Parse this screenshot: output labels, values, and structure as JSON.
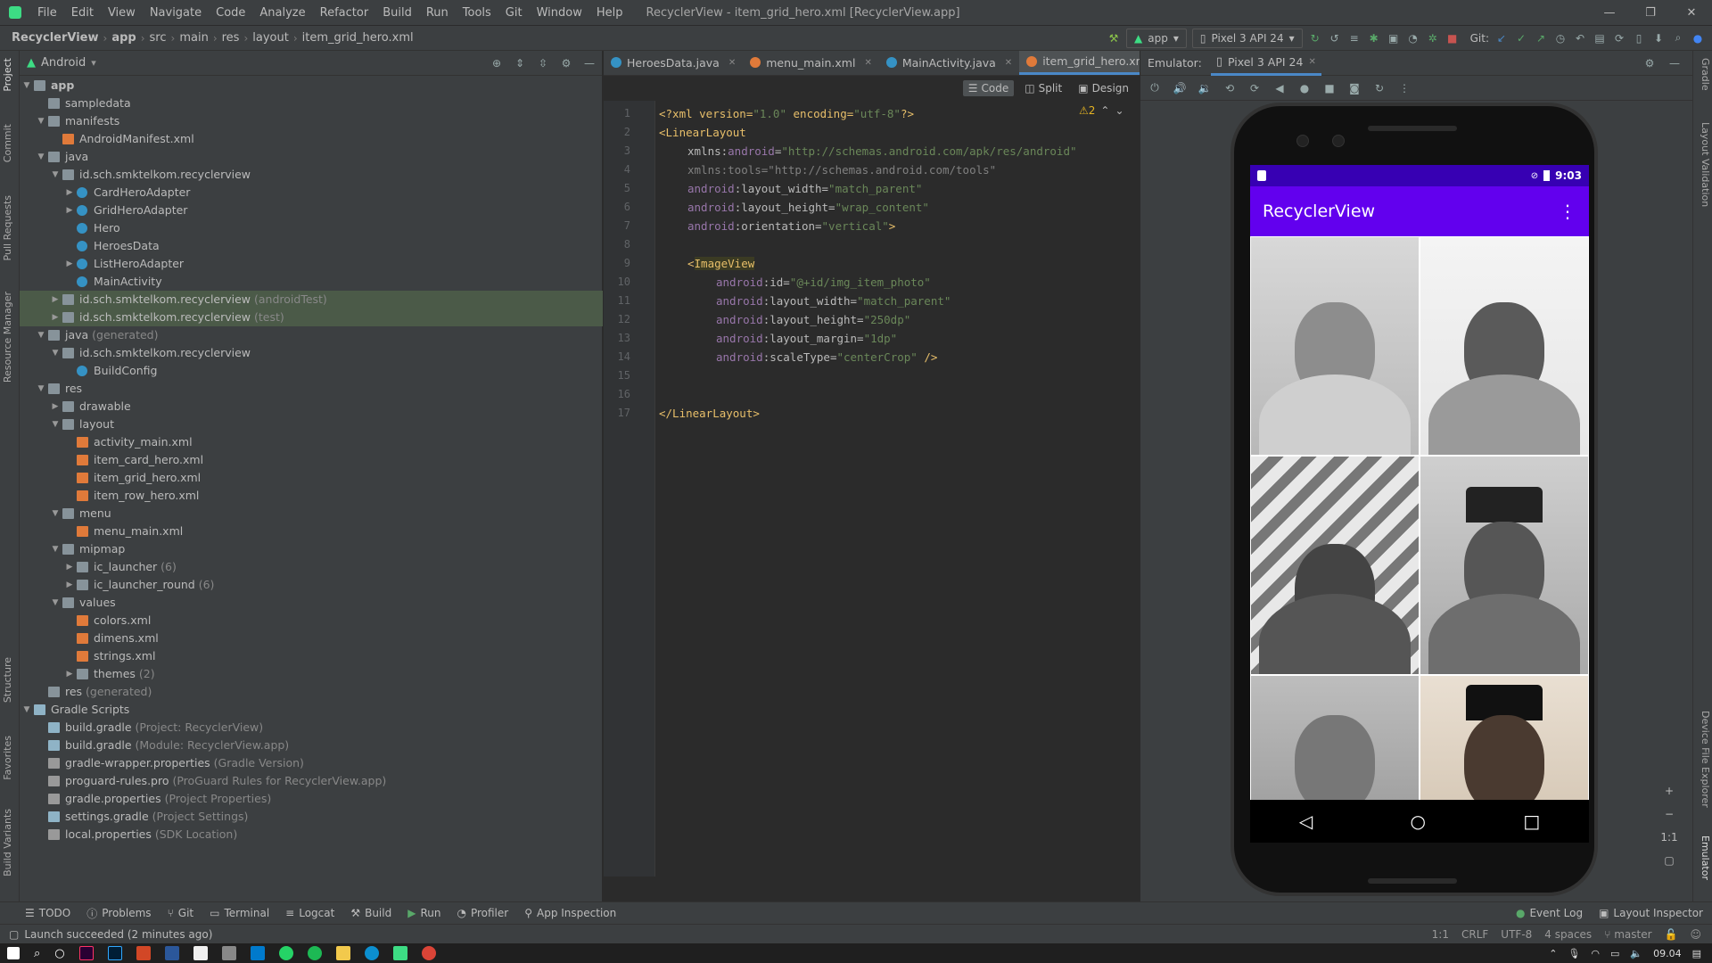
{
  "window": {
    "title": "RecyclerView - item_grid_hero.xml [RecyclerView.app]",
    "menu": [
      "File",
      "Edit",
      "View",
      "Navigate",
      "Code",
      "Analyze",
      "Refactor",
      "Build",
      "Run",
      "Tools",
      "Git",
      "Window",
      "Help"
    ],
    "controls": [
      "—",
      "❐",
      "✕"
    ]
  },
  "breadcrumb": [
    "RecyclerView",
    "app",
    "src",
    "main",
    "res",
    "layout",
    "item_grid_hero.xml"
  ],
  "toolbar": {
    "run_config": "app",
    "device": "Pixel 3 API 24",
    "git_label": "Git:"
  },
  "project_panel": {
    "view_mode": "Android",
    "tree": [
      {
        "label": "app",
        "hint": "",
        "type": "folder",
        "depth": 0,
        "expanded": true,
        "bold": true
      },
      {
        "label": "sampledata",
        "hint": "",
        "type": "folder",
        "depth": 1,
        "expanded": null
      },
      {
        "label": "manifests",
        "hint": "",
        "type": "folder",
        "depth": 1,
        "expanded": true
      },
      {
        "label": "AndroidManifest.xml",
        "hint": "",
        "type": "xml",
        "depth": 2,
        "expanded": null
      },
      {
        "label": "java",
        "hint": "",
        "type": "folder",
        "depth": 1,
        "expanded": true
      },
      {
        "label": "id.sch.smktelkom.recyclerview",
        "hint": "",
        "type": "pkg",
        "depth": 2,
        "expanded": true
      },
      {
        "label": "CardHeroAdapter",
        "hint": "",
        "type": "cls",
        "depth": 3,
        "expanded": false
      },
      {
        "label": "GridHeroAdapter",
        "hint": "",
        "type": "cls",
        "depth": 3,
        "expanded": false
      },
      {
        "label": "Hero",
        "hint": "",
        "type": "cls",
        "depth": 3,
        "expanded": null
      },
      {
        "label": "HeroesData",
        "hint": "",
        "type": "cls",
        "depth": 3,
        "expanded": null
      },
      {
        "label": "ListHeroAdapter",
        "hint": "",
        "type": "cls",
        "depth": 3,
        "expanded": false
      },
      {
        "label": "MainActivity",
        "hint": "",
        "type": "cls",
        "depth": 3,
        "expanded": null
      },
      {
        "label": "id.sch.smktelkom.recyclerview",
        "hint": " (androidTest)",
        "type": "pkg",
        "depth": 2,
        "expanded": false,
        "selected": true
      },
      {
        "label": "id.sch.smktelkom.recyclerview",
        "hint": " (test)",
        "type": "pkg",
        "depth": 2,
        "expanded": false,
        "selected": true
      },
      {
        "label": "java",
        "hint": " (generated)",
        "type": "folder",
        "depth": 1,
        "expanded": true
      },
      {
        "label": "id.sch.smktelkom.recyclerview",
        "hint": "",
        "type": "pkg",
        "depth": 2,
        "expanded": true
      },
      {
        "label": "BuildConfig",
        "hint": "",
        "type": "cls",
        "depth": 3,
        "expanded": null
      },
      {
        "label": "res",
        "hint": "",
        "type": "folder",
        "depth": 1,
        "expanded": true
      },
      {
        "label": "drawable",
        "hint": "",
        "type": "folder",
        "depth": 2,
        "expanded": false
      },
      {
        "label": "layout",
        "hint": "",
        "type": "folder",
        "depth": 2,
        "expanded": true
      },
      {
        "label": "activity_main.xml",
        "hint": "",
        "type": "xml",
        "depth": 3,
        "expanded": null
      },
      {
        "label": "item_card_hero.xml",
        "hint": "",
        "type": "xml",
        "depth": 3,
        "expanded": null
      },
      {
        "label": "item_grid_hero.xml",
        "hint": "",
        "type": "xml",
        "depth": 3,
        "expanded": null
      },
      {
        "label": "item_row_hero.xml",
        "hint": "",
        "type": "xml",
        "depth": 3,
        "expanded": null
      },
      {
        "label": "menu",
        "hint": "",
        "type": "folder",
        "depth": 2,
        "expanded": true
      },
      {
        "label": "menu_main.xml",
        "hint": "",
        "type": "xml",
        "depth": 3,
        "expanded": null
      },
      {
        "label": "mipmap",
        "hint": "",
        "type": "folder",
        "depth": 2,
        "expanded": true
      },
      {
        "label": "ic_launcher",
        "hint": " (6)",
        "type": "folder",
        "depth": 3,
        "expanded": false
      },
      {
        "label": "ic_launcher_round",
        "hint": " (6)",
        "type": "folder",
        "depth": 3,
        "expanded": false
      },
      {
        "label": "values",
        "hint": "",
        "type": "folder",
        "depth": 2,
        "expanded": true
      },
      {
        "label": "colors.xml",
        "hint": "",
        "type": "xml",
        "depth": 3,
        "expanded": null
      },
      {
        "label": "dimens.xml",
        "hint": "",
        "type": "xml",
        "depth": 3,
        "expanded": null
      },
      {
        "label": "strings.xml",
        "hint": "",
        "type": "xml",
        "depth": 3,
        "expanded": null
      },
      {
        "label": "themes",
        "hint": " (2)",
        "type": "folder",
        "depth": 3,
        "expanded": false
      },
      {
        "label": "res",
        "hint": " (generated)",
        "type": "folder",
        "depth": 1,
        "expanded": null
      },
      {
        "label": "Gradle Scripts",
        "hint": "",
        "type": "grd",
        "depth": 0,
        "expanded": true
      },
      {
        "label": "build.gradle",
        "hint": " (Project: RecyclerView)",
        "type": "grd",
        "depth": 1,
        "expanded": null
      },
      {
        "label": "build.gradle",
        "hint": " (Module: RecyclerView.app)",
        "type": "grd",
        "depth": 1,
        "expanded": null
      },
      {
        "label": "gradle-wrapper.properties",
        "hint": " (Gradle Version)",
        "type": "prop",
        "depth": 1,
        "expanded": null
      },
      {
        "label": "proguard-rules.pro",
        "hint": " (ProGuard Rules for RecyclerView.app)",
        "type": "prop",
        "depth": 1,
        "expanded": null
      },
      {
        "label": "gradle.properties",
        "hint": " (Project Properties)",
        "type": "prop",
        "depth": 1,
        "expanded": null
      },
      {
        "label": "settings.gradle",
        "hint": " (Project Settings)",
        "type": "grd",
        "depth": 1,
        "expanded": null
      },
      {
        "label": "local.properties",
        "hint": " (SDK Location)",
        "type": "prop",
        "depth": 1,
        "expanded": null
      }
    ]
  },
  "left_tool_tabs": [
    "Project",
    "Commit",
    "Pull Requests",
    "Resource Manager",
    "Structure",
    "Favorites",
    "Build Variants"
  ],
  "right_tool_tabs": [
    "Gradle",
    "Layout Validation",
    "Device File Explorer",
    "Emulator"
  ],
  "editor_tabs": [
    {
      "label": "HeroesData.java",
      "color": "#3592c4",
      "active": false
    },
    {
      "label": "menu_main.xml",
      "color": "#e07a3a",
      "active": false
    },
    {
      "label": "MainActivity.java",
      "color": "#3592c4",
      "active": false
    },
    {
      "label": "item_grid_hero.xml",
      "color": "#e07a3a",
      "active": true
    }
  ],
  "view_modes": [
    "Code",
    "Split",
    "Design"
  ],
  "warnings": "⚠2",
  "code_lines": [
    "1",
    "2",
    "3",
    "4",
    "5",
    "6",
    "7",
    "8",
    "9",
    "10",
    "11",
    "12",
    "13",
    "14",
    "15",
    "16",
    "17"
  ],
  "code": {
    "l1_a": "<?xml version=",
    "l1_b": "\"1.0\"",
    "l1_c": " encoding=",
    "l1_d": "\"utf-8\"",
    "l1_e": "?>",
    "l2": "<LinearLayout",
    "l3_ns": "xmlns:",
    "l3_attr": "android",
    "l3_eq": "=",
    "l3_val": "\"http://schemas.android.com/apk/res/android\"",
    "l4": "xmlns:tools=\"http://schemas.android.com/tools\"",
    "l5_ns": "android",
    "l5_attr": ":layout_width=",
    "l5_val": "\"match_parent\"",
    "l6_ns": "android",
    "l6_attr": ":layout_height=",
    "l6_val": "\"wrap_content\"",
    "l7_ns": "android",
    "l7_attr": ":orientation=",
    "l7_val": "\"vertical\"",
    "l7_end": ">",
    "l9_open": "<",
    "l9_tag": "ImageView",
    "l10_ns": "android",
    "l10_attr": ":id=",
    "l10_val": "\"@+id/img_item_photo\"",
    "l11_ns": "android",
    "l11_attr": ":layout_width=",
    "l11_val": "\"match_parent\"",
    "l12_ns": "android",
    "l12_attr": ":layout_height=",
    "l12_val": "\"250dp\"",
    "l13_ns": "android",
    "l13_attr": ":layout_margin=",
    "l13_val": "\"1dp\"",
    "l14_ns": "android",
    "l14_attr": ":scaleType=",
    "l14_val": "\"centerCrop\"",
    "l14_end": " />",
    "l17": "</LinearLayout>"
  },
  "emulator": {
    "label": "Emulator:",
    "device_tab": "Pixel 3 API 24",
    "status_time": "9:03",
    "app_title": "RecyclerView",
    "zoom_label": "1:1"
  },
  "bottom_tools": [
    "TODO",
    "Problems",
    "Git",
    "Terminal",
    "Logcat",
    "Build",
    "Run",
    "Profiler",
    "App Inspection"
  ],
  "bottom_right_tools": [
    "Event Log",
    "Layout Inspector"
  ],
  "status": {
    "message": "Launch succeeded (2 minutes ago)",
    "position": "1:1",
    "line_sep": "CRLF",
    "encoding": "UTF-8",
    "indent": "4 spaces",
    "branch": "master"
  },
  "taskbar": {
    "time": "09.04"
  },
  "colors": {
    "accent": "#4a88c7",
    "app_primary": "#6200ee",
    "app_status": "#3700b3"
  }
}
